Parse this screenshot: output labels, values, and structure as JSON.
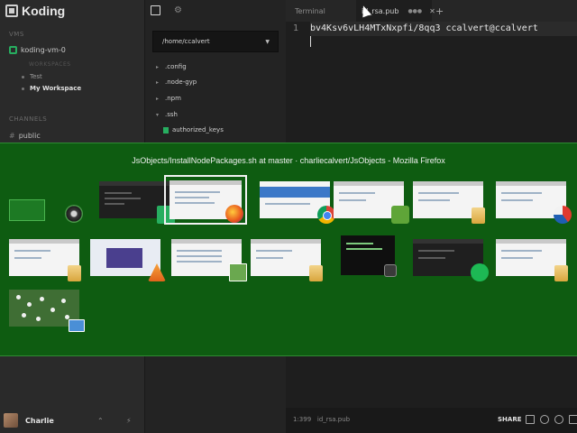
{
  "sidebar": {
    "brand": "Koding",
    "vms_label": "VMS",
    "vm_name": "koding-vm-0",
    "workspaces_label": "WORKSPACES",
    "workspaces": [
      "Test",
      "My Workspace"
    ],
    "channels_label": "CHANNELS",
    "channel": "public",
    "user": "Charlie"
  },
  "filetree": {
    "path": "/home/ccalvert",
    "items": [
      ".config",
      ".node-gyp",
      ".npm",
      ".ssh"
    ],
    "file": "authorized_keys"
  },
  "editor": {
    "tabs": [
      "Terminal",
      "id_rsa.pub"
    ],
    "line_number": "1",
    "code": "bv4Ksv6vLH4MTxNxpfi/8qq3 ccalvert@ccalvert",
    "status_position": "1:399",
    "status_file": "id_rsa.pub",
    "share_label": "SHARE"
  },
  "switcher": {
    "title": "JsObjects/InstallNodePackages.sh at master · charliecalvert/JsObjects - Mozilla Firefox"
  },
  "colors": {
    "switcher_bg": "#0e5c11",
    "accent_green": "#27ae60"
  },
  "icons": [
    "koding-logo-icon",
    "folder-icon",
    "gear-icon",
    "caret-down-icon",
    "bolt-icon",
    "github-icon",
    "firefox-icon",
    "chrome-icon",
    "evernote-icon",
    "spotify-icon",
    "vlc-icon"
  ]
}
